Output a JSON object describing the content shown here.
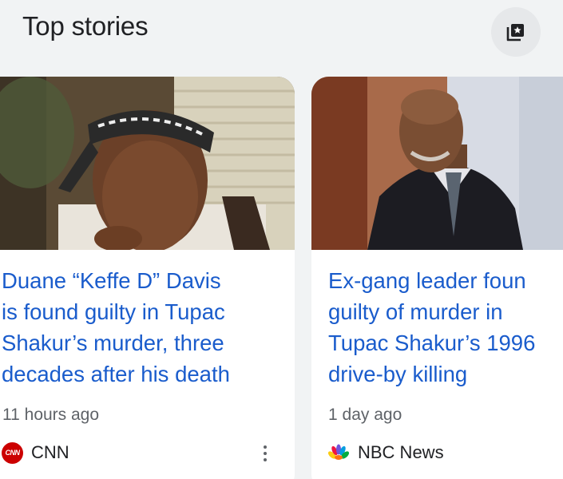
{
  "header": {
    "title": "Top stories",
    "action_icon": "saved-stories-icon"
  },
  "stories": [
    {
      "headline_lines": [
        "Duane “Keffe D” Davis",
        "is found guilty in Tupac",
        "Shakur’s murder, three",
        "decades after his death"
      ],
      "time": "11 hours ago",
      "source": "CNN",
      "source_logo_text": "CNN",
      "menu_icon": "more-vert-icon"
    },
    {
      "headline_lines": [
        "Ex-gang leader foun",
        "guilty of murder in",
        "Tupac Shakur’s 1996",
        "drive-by killing"
      ],
      "time": "1 day ago",
      "source": "NBC News",
      "source_logo_icon": "nbc-peacock-icon"
    }
  ],
  "colors": {
    "headline": "#1a5ccc",
    "meta": "#5f6368",
    "background": "#f1f3f4",
    "card": "#ffffff",
    "cnn_red": "#cc0000"
  }
}
